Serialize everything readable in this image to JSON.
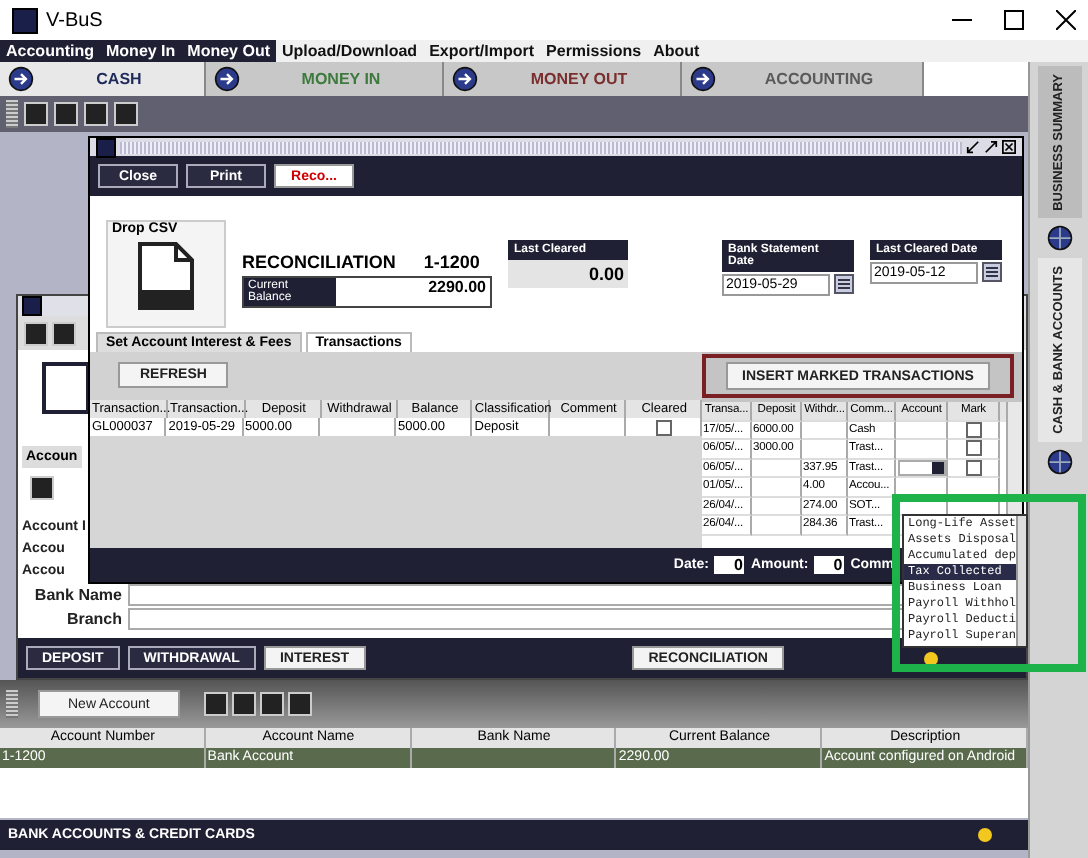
{
  "window": {
    "title": "V-BuS"
  },
  "menu": [
    {
      "label": "Accounting",
      "kind": "module"
    },
    {
      "label": "Money In",
      "kind": "module"
    },
    {
      "label": "Money Out",
      "kind": "module"
    },
    {
      "label": "Upload/Download",
      "kind": "plain"
    },
    {
      "label": "Export/Import",
      "kind": "plain"
    },
    {
      "label": "Permissions",
      "kind": "plain"
    },
    {
      "label": "About",
      "kind": "plain"
    }
  ],
  "modules": [
    {
      "label": "CASH",
      "selected": true,
      "color": "#1f2b5a"
    },
    {
      "label": "MONEY IN",
      "selected": false,
      "color": "#3d7a3d"
    },
    {
      "label": "MONEY OUT",
      "selected": false,
      "color": "#7a2e2e"
    },
    {
      "label": "ACCOUNTING",
      "selected": false,
      "color": "#5a5a5a"
    }
  ],
  "side_tabs": [
    {
      "label": "BUSINESS SUMMARY",
      "selected": false
    },
    {
      "label": "CASH & BANK ACCOUNTS",
      "selected": true
    }
  ],
  "editor": {
    "tab": "Accoun",
    "fields": [
      {
        "label": "Account I",
        "kind": "clipped"
      },
      {
        "label": "Accou",
        "kind": "clipped"
      },
      {
        "label": "Accou",
        "kind": "clipped"
      },
      {
        "label": "Bank Name",
        "kind": "field"
      },
      {
        "label": "Branch",
        "kind": "field"
      }
    ],
    "buttons": [
      {
        "label": "DEPOSIT",
        "kind": "dark"
      },
      {
        "label": "WITHDRAWAL",
        "kind": "dark"
      },
      {
        "label": "INTEREST",
        "kind": "light"
      }
    ],
    "reconcile_button": "RECONCILIATION"
  },
  "accounts": {
    "new_button": "New Account",
    "columns": [
      "Account Number",
      "Account Name",
      "Bank Name",
      "Current Balance",
      "Description"
    ],
    "rows": [
      {
        "cells": [
          "1-1200",
          "Bank Account",
          null,
          "2290.00",
          "Account configured on Android"
        ],
        "selected": true
      }
    ],
    "footer": "BANK ACCOUNTS & CREDIT CARDS"
  },
  "dialog": {
    "buttons": [
      {
        "label": "Close",
        "kind": "dark"
      },
      {
        "label": "Print",
        "kind": "dark"
      },
      {
        "label": "Reco...",
        "kind": "alert"
      }
    ],
    "drop_label": "Drop CSV",
    "title": "RECONCILIATION",
    "account": "1-1200",
    "balance_label": "Current Balance",
    "balance": "2290.00",
    "last_cleared": {
      "label": "Last Cleared",
      "value": "0.00"
    },
    "dates": [
      {
        "label": "Bank Statement Date",
        "value": "2019-05-29"
      },
      {
        "label": "Last Cleared Date",
        "value": "2019-05-12"
      }
    ],
    "tabs": [
      {
        "label": "Set Account Interest & Fees",
        "selected": false
      },
      {
        "label": "Transactions",
        "selected": true
      }
    ],
    "refresh": "REFRESH",
    "ledger": {
      "columns": [
        "Transaction...",
        "Transaction...",
        "Deposit",
        "Withdrawal",
        "Balance",
        "Classification",
        "Comment",
        "Cleared"
      ],
      "rows": [
        {
          "cells": [
            "GL000037",
            "2019-05-29",
            "5000.00",
            null,
            "5000.00",
            "Deposit",
            null
          ],
          "cleared": false
        }
      ]
    },
    "insert_button": "INSERT MARKED TRANSACTIONS",
    "bank": {
      "columns": [
        "Transa...",
        "Deposit",
        "Withdr...",
        "Comm...",
        "Account",
        "Mark"
      ],
      "rows": [
        {
          "cells": [
            "17/05/...",
            "6000.00",
            null,
            "Cash"
          ],
          "marked": false
        },
        {
          "cells": [
            "06/05/...",
            "3000.00",
            null,
            "Trast..."
          ],
          "marked": false
        },
        {
          "cells": [
            "06/05/...",
            null,
            "337.95",
            "Trast..."
          ],
          "marked": false,
          "combo": true
        },
        {
          "cells": [
            "01/05/...",
            null,
            "4.00",
            "Accou..."
          ]
        },
        {
          "cells": [
            "26/04/...",
            null,
            "274.00",
            "SOT..."
          ]
        },
        {
          "cells": [
            "26/04/...",
            null,
            "284.36",
            "Trast..."
          ]
        }
      ]
    },
    "filters": [
      {
        "label": "Date:",
        "value": "0"
      },
      {
        "label": "Amount:",
        "value": "0"
      }
    ],
    "filter_cut": "Comm"
  },
  "account_dropdown": {
    "options": [
      {
        "label": "Long-Life Asset",
        "selected": false
      },
      {
        "label": "Assets Disposal",
        "selected": false
      },
      {
        "label": "Accumulated dep",
        "selected": false
      },
      {
        "label": "Tax Collected",
        "selected": true
      },
      {
        "label": "Business Loan",
        "selected": false
      },
      {
        "label": "Payroll Withhol",
        "selected": false
      },
      {
        "label": "Payroll Deducti",
        "selected": false
      },
      {
        "label": "Payroll Superan",
        "selected": false
      }
    ]
  }
}
